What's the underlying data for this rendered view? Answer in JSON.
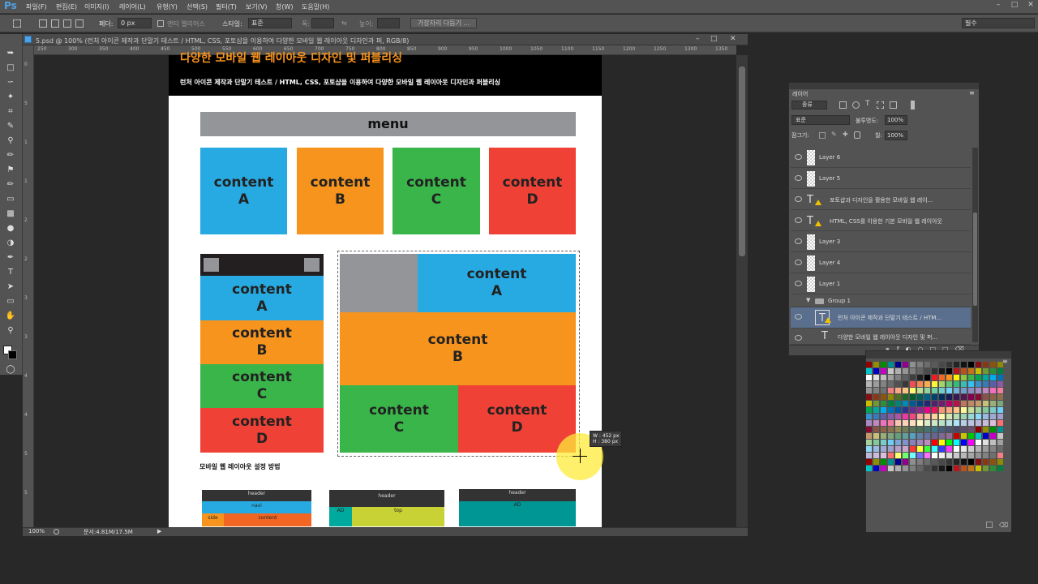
{
  "app": {
    "logo": "Ps"
  },
  "menubar": {
    "items": [
      "파일(F)",
      "편집(E)",
      "이미지(I)",
      "레이어(L)",
      "유형(Y)",
      "선택(S)",
      "필터(T)",
      "보기(V)",
      "창(W)",
      "도움말(H)"
    ]
  },
  "options_bar": {
    "feather_label": "페더:",
    "feather_value": "0 px",
    "antialias_label": "앤티 앨리어스",
    "style_label": "스타일:",
    "style_value": "표준",
    "width_label": "폭:",
    "height_label": "높이:",
    "refine_edge_button": "가장자리 다듬기 ...",
    "workspace_value": "필수"
  },
  "document": {
    "tab_title": "5.psd @ 100% (런처 아이콘 제작과 단말기 테스트 / HTML, CSS, 포토샵을 이용하여 다양한 모바일 웹 레이아웃 디자인과 퍼, RGB/8)",
    "ruler_marks": [
      "250",
      "300",
      "350",
      "400",
      "450",
      "500",
      "550",
      "600",
      "650",
      "700",
      "750",
      "800",
      "850",
      "900",
      "950",
      "1000",
      "1050",
      "1100",
      "1150",
      "1200",
      "1250",
      "1300",
      "1350"
    ],
    "ruler_marks_v": [
      "0",
      "5",
      "1",
      "1",
      "2",
      "2",
      "3",
      "3",
      "4",
      "4",
      "5",
      "5"
    ],
    "zoom": "100%",
    "doc_size": "문서:4.81M/17.5M"
  },
  "page": {
    "big_title": "다양한 모바일 웹 레이아웃 디자인 및 퍼블리싱",
    "subtitle": "런처 아이콘 제작과 단말기 테스트 / HTML, CSS, 포토샵을 이용하여 다양한 모바일 웹 레이아웃 디자인과 퍼블리싱",
    "menu_label": "menu",
    "content_word": "content",
    "letters": {
      "a": "A",
      "b": "B",
      "c": "C",
      "d": "D"
    },
    "section_title": "모바일 웹 레이아웃 설정 방법",
    "mini_layouts": {
      "m1": {
        "header": "header",
        "navi": "navi",
        "side": "side",
        "content": "content"
      },
      "m2": {
        "header": "header",
        "ad": "AD",
        "top": "top"
      },
      "m3": {
        "header": "header",
        "ad": "AD"
      }
    }
  },
  "size_tooltip": {
    "w": "W : 452 px",
    "h": "H : 380 px"
  },
  "layers_panel": {
    "title": "레이어",
    "filter_kind": "종류",
    "blend_mode": "표준",
    "opacity_label": "불투명도:",
    "opacity_value": "100%",
    "lock_label": "잠그기:",
    "fill_label": "칠:",
    "fill_value": "100%",
    "layers": [
      {
        "name": "Layer 6"
      },
      {
        "name": "Layer 5"
      },
      {
        "name": "포토샵과 디자인을 활용한 모바일 웹 레이..."
      },
      {
        "name": "HTML, CSS를 이용한 기본 모바일 웹 레이아웃"
      },
      {
        "name": "Layer 3"
      },
      {
        "name": "Layer 4"
      },
      {
        "name": "Layer 1"
      },
      {
        "name": "Group 1"
      },
      {
        "name": "런처 아이콘 제작과 단말기 테스트 / HTM..."
      },
      {
        "name": "다양한 모바일 웹 레이아웃 디자인 및 퍼..."
      }
    ]
  },
  "swatch_colors": {
    "palette": [
      "#ff0000",
      "#ffff00",
      "#00ff00",
      "#00ffff",
      "#0000ff",
      "#ff00ff",
      "#ffffff",
      "#e0e0e0",
      "#c0c0c0",
      "#a0a0a0",
      "#808080",
      "#606060",
      "#404040",
      "#202020",
      "#000000",
      "#ed1c24",
      "#f26522",
      "#f7941d",
      "#fff200",
      "#8dc63f",
      "#39b54a",
      "#00a651",
      "#00a99d",
      "#00aeef",
      "#0072bc",
      "#0054a6",
      "#2e3192",
      "#662d91",
      "#92278f",
      "#ec008c",
      "#ed145b",
      "#f69679",
      "#f9ad81",
      "#fdc689",
      "#fff799",
      "#c4df9b",
      "#a3d39c",
      "#82ca9c",
      "#7accc8",
      "#6dcff6",
      "#7da7d9",
      "#8393ca",
      "#8781bd",
      "#a187be",
      "#bd8cbf"
    ]
  }
}
